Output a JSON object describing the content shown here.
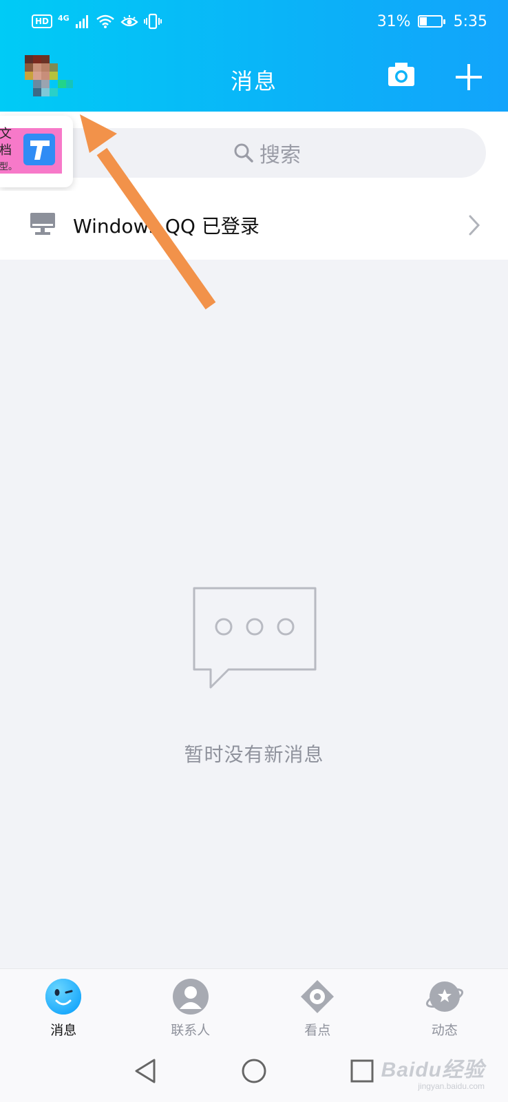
{
  "status_bar": {
    "network_badge": "HD",
    "network_type": "4G",
    "battery": "31%",
    "time": "5:35",
    "icons": [
      "signal-icon",
      "wifi-icon",
      "eye-comfort-icon",
      "vibrate-icon",
      "battery-icon"
    ]
  },
  "header": {
    "title": "消息",
    "avatar": "avatar",
    "actions": [
      "camera-icon",
      "plus-icon"
    ]
  },
  "search": {
    "placeholder": "搜索"
  },
  "doc_card": {
    "line1": "文档",
    "line2": "型。"
  },
  "login_notice": {
    "text": "Windows QQ 已登录"
  },
  "empty_state": {
    "text": "暂时没有新消息"
  },
  "tabs": [
    {
      "label": "消息",
      "icon": "messages-face-icon",
      "active": true
    },
    {
      "label": "联系人",
      "icon": "contacts-person-icon",
      "active": false
    },
    {
      "label": "看点",
      "icon": "eye-icon",
      "active": false
    },
    {
      "label": "动态",
      "icon": "planet-star-icon",
      "active": false
    }
  ],
  "navbar": {
    "icons": [
      "back-icon",
      "home-icon",
      "recents-icon"
    ]
  },
  "watermark": {
    "main": "Baidu经验",
    "sub": "jingyan.baidu.com"
  },
  "colors": {
    "header_gradient_start": "#00cbf6",
    "header_gradient_end": "#12a4fb",
    "annotation_arrow": "#f2924a",
    "page_background": "#f2f3f7"
  }
}
